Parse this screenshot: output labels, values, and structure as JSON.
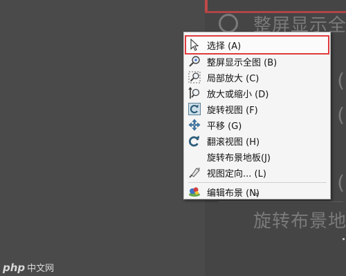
{
  "menu": {
    "items": [
      {
        "label": "选择 (A)",
        "icon": "cursor-arrow-icon",
        "highlighted": true
      },
      {
        "label": "整屏显示全图 (B)",
        "icon": "zoom-to-fit-icon"
      },
      {
        "label": "局部放大 (C)",
        "icon": "zoom-to-area-icon"
      },
      {
        "label": "放大或缩小 (D)",
        "icon": "zoom-in-out-icon"
      },
      {
        "label": "旋转视图 (F)",
        "icon": "rotate-view-icon"
      },
      {
        "label": "平移 (G)",
        "icon": "pan-icon"
      },
      {
        "label": "翻滚视图 (H)",
        "icon": "roll-view-icon"
      },
      {
        "label": "旋转布景地板(J)",
        "icon": ""
      },
      {
        "label": "视图定向... (L)",
        "icon": "view-orientation-icon"
      },
      {
        "label": "编辑布景 (N)",
        "icon": "edit-scene-icon"
      }
    ],
    "more_label": "»"
  },
  "background": {
    "zoom_text_top": "整屏显示全",
    "zoom_text_bottom": "旋转布景地",
    "paren": "("
  },
  "watermark": {
    "logo": "php",
    "text": "中文网"
  },
  "colors": {
    "highlight_border": "#e0393e",
    "menu_background": "#f5f5f5",
    "page_background": "#4a4a4a"
  }
}
